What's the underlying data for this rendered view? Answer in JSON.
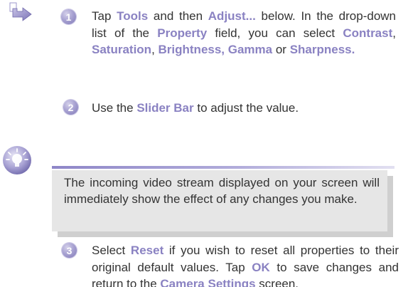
{
  "step1": {
    "number": "1",
    "t1": "Tap ",
    "tools": "Tools",
    "t2": " and  then ",
    "adjust": "Adjust...",
    "t3": " below. In the drop-down list of the ",
    "property": "Property",
    "t4": " field, you can select ",
    "contrast": "Contrast",
    "t5": ", ",
    "saturation": "Saturation",
    "t6": ", ",
    "brightness": "Brightness, Gamma",
    "t7": " or ",
    "sharpness": "Sharpness."
  },
  "step2": {
    "number": "2",
    "t1": "Use the ",
    "slider_bar": "Slider Bar",
    "t2": " to adjust the value."
  },
  "note": {
    "text": "The incoming video stream displayed on your screen will immediately show the effect of any changes you make."
  },
  "step3": {
    "number": "3",
    "t1": "Select ",
    "reset": "Reset",
    "t2": " if you wish to reset all properties to their original default values.  Tap ",
    "ok": "OK",
    "t3": " to save changes and return to the ",
    "camera_settings": "Camera Settings",
    "t4": " screen."
  },
  "colors": {
    "accent": "#8a82c2",
    "note_background": "#e6e6e6"
  },
  "icons": {
    "procedure": "arrow-right-icon",
    "tip": "lightbulb-icon"
  }
}
